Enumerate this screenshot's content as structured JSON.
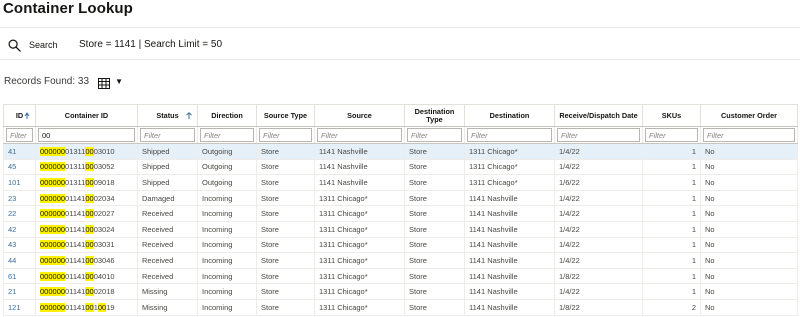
{
  "title": "Container Lookup",
  "search": {
    "label": "Search",
    "criteria": "Store = 1141 | Search Limit = 50"
  },
  "records_found": "Records Found: 33",
  "colors": {
    "highlight": "#fff200",
    "selected_row": "#e6f0f8",
    "id_link": "#3c6e9d"
  },
  "icons": {
    "search": "search-icon",
    "view": "view-icon",
    "caret": "caret-down-icon",
    "sort": "sort-ascending-icon"
  },
  "columns": [
    {
      "key": "id",
      "label": "ID",
      "sortable": true
    },
    {
      "key": "container_id",
      "label": "Container ID"
    },
    {
      "key": "status",
      "label": "Status",
      "sortable": true
    },
    {
      "key": "direction",
      "label": "Direction"
    },
    {
      "key": "source_type",
      "label": "Source Type"
    },
    {
      "key": "source",
      "label": "Source"
    },
    {
      "key": "destination_type",
      "label": "Destination Type"
    },
    {
      "key": "destination",
      "label": "Destination"
    },
    {
      "key": "date",
      "label": "Receive/Dispatch Date"
    },
    {
      "key": "skus",
      "label": "SKUs"
    },
    {
      "key": "customer_order",
      "label": "Customer Order"
    }
  ],
  "filters": {
    "placeholder": "Filter",
    "container_id_value": "00"
  },
  "rows": [
    {
      "id": "41",
      "container_id": "000000013110003010",
      "status": "Shipped",
      "direction": "Outgoing",
      "source_type": "Store",
      "source": "1141 Nashville",
      "destination_type": "Store",
      "destination": "1311 Chicago*",
      "date": "1/4/22",
      "skus": "1",
      "customer_order": "No"
    },
    {
      "id": "45",
      "container_id": "000000013110003052",
      "status": "Shipped",
      "direction": "Outgoing",
      "source_type": "Store",
      "source": "1141 Nashville",
      "destination_type": "Store",
      "destination": "1311 Chicago*",
      "date": "1/4/22",
      "skus": "1",
      "customer_order": "No"
    },
    {
      "id": "101",
      "container_id": "000000013110009018",
      "status": "Shipped",
      "direction": "Outgoing",
      "source_type": "Store",
      "source": "1141 Nashville",
      "destination_type": "Store",
      "destination": "1311 Chicago*",
      "date": "1/6/22",
      "skus": "1",
      "customer_order": "No"
    },
    {
      "id": "23",
      "container_id": "000000011410002034",
      "status": "Damaged",
      "direction": "Incoming",
      "source_type": "Store",
      "source": "1311 Chicago*",
      "destination_type": "Store",
      "destination": "1141 Nashville",
      "date": "1/4/22",
      "skus": "1",
      "customer_order": "No"
    },
    {
      "id": "22",
      "container_id": "000000011410002027",
      "status": "Received",
      "direction": "Incoming",
      "source_type": "Store",
      "source": "1311 Chicago*",
      "destination_type": "Store",
      "destination": "1141 Nashville",
      "date": "1/4/22",
      "skus": "1",
      "customer_order": "No"
    },
    {
      "id": "42",
      "container_id": "000000011410003024",
      "status": "Received",
      "direction": "Incoming",
      "source_type": "Store",
      "source": "1311 Chicago*",
      "destination_type": "Store",
      "destination": "1141 Nashville",
      "date": "1/4/22",
      "skus": "1",
      "customer_order": "No"
    },
    {
      "id": "43",
      "container_id": "000000011410003031",
      "status": "Received",
      "direction": "Incoming",
      "source_type": "Store",
      "source": "1311 Chicago*",
      "destination_type": "Store",
      "destination": "1141 Nashville",
      "date": "1/4/22",
      "skus": "1",
      "customer_order": "No"
    },
    {
      "id": "44",
      "container_id": "000000011410003046",
      "status": "Received",
      "direction": "Incoming",
      "source_type": "Store",
      "source": "1311 Chicago*",
      "destination_type": "Store",
      "destination": "1141 Nashville",
      "date": "1/4/22",
      "skus": "1",
      "customer_order": "No"
    },
    {
      "id": "61",
      "container_id": "000000011410004010",
      "status": "Received",
      "direction": "Incoming",
      "source_type": "Store",
      "source": "1311 Chicago*",
      "destination_type": "Store",
      "destination": "1141 Nashville",
      "date": "1/8/22",
      "skus": "1",
      "customer_order": "No"
    },
    {
      "id": "21",
      "container_id": "000000011410002018",
      "status": "Missing",
      "direction": "Incoming",
      "source_type": "Store",
      "source": "1311 Chicago*",
      "destination_type": "Store",
      "destination": "1141 Nashville",
      "date": "1/4/22",
      "skus": "1",
      "customer_order": "No"
    },
    {
      "id": "121",
      "container_id": "000000011410010019",
      "status": "Missing",
      "direction": "Incoming",
      "source_type": "Store",
      "source": "1311 Chicago*",
      "destination_type": "Store",
      "destination": "1141 Nashville",
      "date": "1/8/22",
      "skus": "2",
      "customer_order": "No"
    }
  ]
}
